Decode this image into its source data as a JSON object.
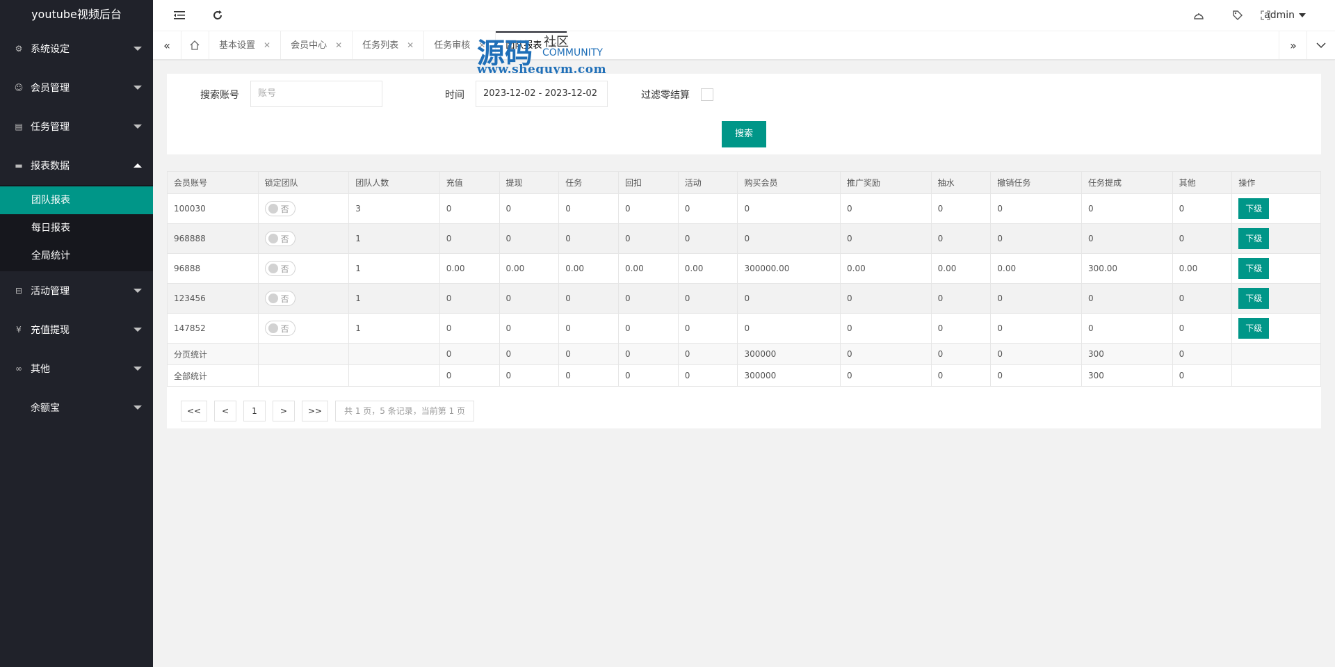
{
  "app": {
    "title": "youtube视频后台"
  },
  "sidebar": {
    "items": [
      {
        "label": "系统设定",
        "icon": "gear-icon",
        "open": false
      },
      {
        "label": "会员管理",
        "icon": "user-icon",
        "open": false
      },
      {
        "label": "任务管理",
        "icon": "file-icon",
        "open": false
      },
      {
        "label": "报表数据",
        "icon": "report-icon",
        "open": true,
        "children": [
          {
            "label": "团队报表",
            "active": true
          },
          {
            "label": "每日报表",
            "active": false
          },
          {
            "label": "全局统计",
            "active": false
          }
        ]
      },
      {
        "label": "活动管理",
        "icon": "bus-icon",
        "open": false
      },
      {
        "label": "充值提现",
        "icon": "yen-icon",
        "open": false
      },
      {
        "label": "其他",
        "icon": "link-icon",
        "open": false
      },
      {
        "label": "余额宝",
        "icon": "",
        "open": false
      }
    ]
  },
  "header": {
    "user": "admin"
  },
  "tabs": [
    {
      "label": "基本设置"
    },
    {
      "label": "会员中心"
    },
    {
      "label": "任务列表"
    },
    {
      "label": "任务审核"
    },
    {
      "label": "团队报表",
      "active": true
    }
  ],
  "watermark": {
    "main": "源码",
    "community_cn": "社区",
    "community_en": "COMMUNITY",
    "url": "www.shequym.com"
  },
  "search": {
    "account_label": "搜索账号",
    "account_placeholder": "账号",
    "time_label": "时间",
    "time_value": "2023-12-02 - 2023-12-02",
    "filter_label": "过滤零结算",
    "button": "搜索"
  },
  "table": {
    "headers": [
      "会员账号",
      "锁定团队",
      "团队人数",
      "充值",
      "提现",
      "任务",
      "回扣",
      "活动",
      "购买会员",
      "推广奖励",
      "抽水",
      "撤销任务",
      "任务提成",
      "其他",
      "操作"
    ],
    "switch_label": "否",
    "action_label": "下级",
    "rows": [
      [
        "100030",
        "3",
        "0",
        "0",
        "0",
        "0",
        "0",
        "0",
        "0",
        "0",
        "0",
        "0",
        "0"
      ],
      [
        "968888",
        "1",
        "0",
        "0",
        "0",
        "0",
        "0",
        "0",
        "0",
        "0",
        "0",
        "0",
        "0"
      ],
      [
        "96888",
        "1",
        "0.00",
        "0.00",
        "0.00",
        "0.00",
        "0.00",
        "300000.00",
        "0.00",
        "0.00",
        "0.00",
        "300.00",
        "0.00"
      ],
      [
        "123456",
        "1",
        "0",
        "0",
        "0",
        "0",
        "0",
        "0",
        "0",
        "0",
        "0",
        "0",
        "0"
      ],
      [
        "147852",
        "1",
        "0",
        "0",
        "0",
        "0",
        "0",
        "0",
        "0",
        "0",
        "0",
        "0",
        "0"
      ]
    ],
    "summary": [
      [
        "分页统计",
        "0",
        "0",
        "0",
        "0",
        "0",
        "300000",
        "0",
        "0",
        "0",
        "300",
        "0"
      ],
      [
        "全部统计",
        "0",
        "0",
        "0",
        "0",
        "0",
        "300000",
        "0",
        "0",
        "0",
        "300",
        "0"
      ]
    ]
  },
  "pager": {
    "first": "<<",
    "prev": "<",
    "page": "1",
    "next": ">",
    "last": ">>",
    "info": "共 1 页，5 条记录，当前第 1 页"
  }
}
